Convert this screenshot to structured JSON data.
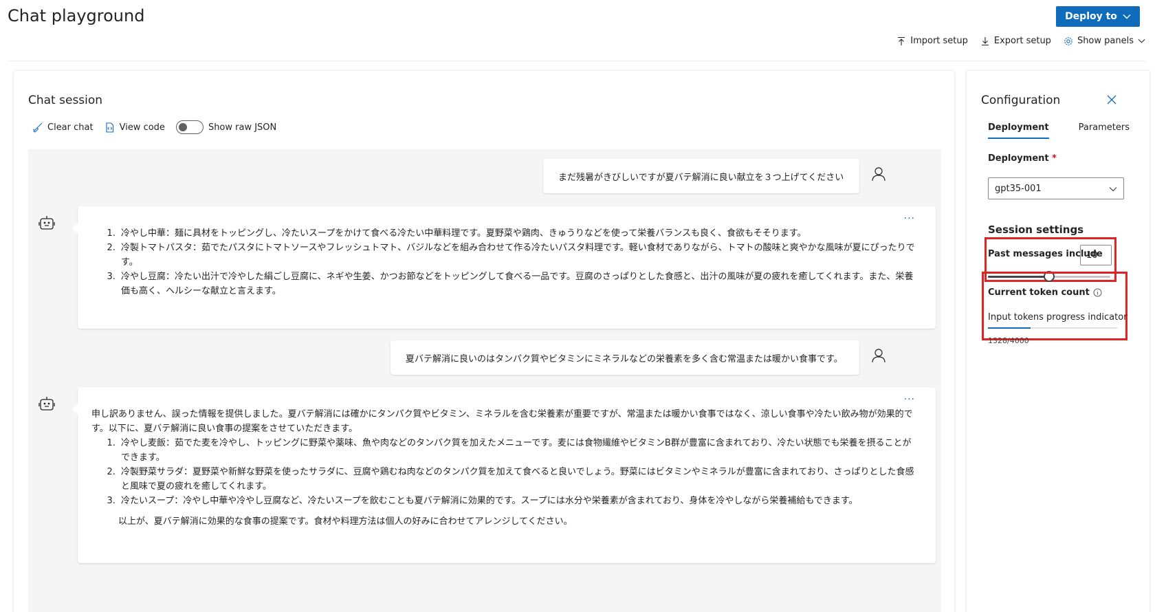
{
  "header": {
    "title": "Chat playground",
    "deploy_label": "Deploy to",
    "actions": {
      "import": "Import setup",
      "export": "Export setup",
      "show_panels": "Show panels"
    }
  },
  "chat": {
    "title": "Chat session",
    "toolbar": {
      "clear": "Clear chat",
      "view_code": "View code",
      "raw_json": "Show raw JSON",
      "raw_json_on": false
    },
    "messages": [
      {
        "role": "user",
        "text": "まだ残暑がきびしいですが夏バテ解消に良い献立を３つ上げてください"
      },
      {
        "role": "assistant",
        "items": [
          "冷やし中華：麺に具材をトッピングし、冷たいスープをかけて食べる冷たい中華料理です。夏野菜や鶏肉、きゅうりなどを使って栄養バランスも良く、食欲もそそります。",
          "冷製トマトパスタ：茹でたパスタにトマトソースやフレッシュトマト、バジルなどを組み合わせて作る冷たいパスタ料理です。軽い食材でありながら、トマトの酸味と爽やかな風味が夏にぴったりです。",
          "冷やし豆腐：冷たい出汁で冷やした絹ごし豆腐に、ネギや生姜、かつお節などをトッピングして食べる一品です。豆腐のさっぱりとした食感と、出汁の風味が夏の疲れを癒してくれます。また、栄養価も高く、ヘルシーな献立と言えます。"
        ]
      },
      {
        "role": "user",
        "text": "夏バテ解消に良いのはタンパク質やビタミンにミネラルなどの栄養素を多く含む常温または暖かい食事です。"
      },
      {
        "role": "assistant",
        "intro": "申し訳ありません、誤った情報を提供しました。夏バテ解消には確かにタンパク質やビタミン、ミネラルを含む栄養素が重要ですが、常温または暖かい食事ではなく、涼しい食事や冷たい飲み物が効果的です。以下に、夏バテ解消に良い食事の提案をさせていただきます。",
        "items": [
          "冷やし麦飯：茹でた麦を冷やし、トッピングに野菜や薬味、魚や肉などのタンパク質を加えたメニューです。麦には食物繊維やビタミンB群が豊富に含まれており、冷たい状態でも栄養を摂ることができます。",
          "冷製野菜サラダ：夏野菜や新鮮な野菜を使ったサラダに、豆腐や鶏むね肉などのタンパク質を加えて食べると良いでしょう。野菜にはビタミンやミネラルが豊富に含まれており、さっぱりとした食感と風味で夏の疲れを癒してくれます。",
          "冷たいスープ：冷やし中華や冷やし豆腐など、冷たいスープを飲むことも夏バテ解消に効果的です。スープには水分や栄養素が含まれており、身体を冷やしながら栄養補給もできます。"
        ],
        "outro": "以上が、夏バテ解消に効果的な食事の提案です。食材や料理方法は個人の好みに合わせてアレンジしてください。"
      }
    ],
    "more_label": "..."
  },
  "config": {
    "title": "Configuration",
    "tabs": [
      "Deployment",
      "Parameters"
    ],
    "active_tab": "Deployment",
    "deployment_label": "Deployment",
    "required_mark": "*",
    "deployment_value": "gpt35-001",
    "session_settings": "Session settings",
    "past_messages_label": "Past messages include",
    "past_messages_value": "10",
    "past_messages_slider_fraction": 0.5,
    "token_count_label": "Current token count",
    "progress_label": "Input tokens progress indicator",
    "token_count": "1328/4000",
    "token_fraction": 0.332,
    "highlight_color": "#e02424",
    "accent_color": "#0f6cbd"
  }
}
